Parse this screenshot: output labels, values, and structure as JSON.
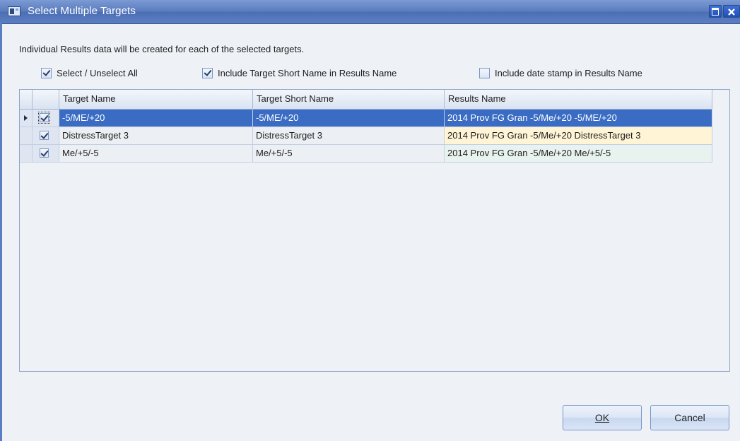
{
  "window": {
    "title": "Select Multiple Targets"
  },
  "description": "Individual Results data will be created for each of the selected targets.",
  "options": [
    {
      "label": "Select / Unselect All",
      "checked": true
    },
    {
      "label": "Include Target Short Name in Results Name",
      "checked": true
    },
    {
      "label": "Include date stamp in Results Name",
      "checked": false
    }
  ],
  "grid": {
    "columns": [
      "Target Name",
      "Target Short Name",
      "Results Name"
    ],
    "rows": [
      {
        "checked": true,
        "target_name": "-5/ME/+20",
        "short_name": "-5/ME/+20",
        "results_name": "2014 Prov FG Gran -5/Me/+20 -5/ME/+20",
        "selected": true
      },
      {
        "checked": true,
        "target_name": "DistressTarget 3",
        "short_name": "DistressTarget 3",
        "results_name": "2014 Prov FG Gran -5/Me/+20 DistressTarget 3",
        "selected": false
      },
      {
        "checked": true,
        "target_name": "Me/+5/-5",
        "short_name": "Me/+5/-5",
        "results_name": "2014 Prov FG Gran -5/Me/+20 Me/+5/-5",
        "selected": false
      }
    ]
  },
  "buttons": {
    "ok": "OK",
    "cancel": "Cancel"
  },
  "colors": {
    "titlebar": "#5a7cbf",
    "selected_row": "#3a6cc3",
    "highlight_row": "#fff4d6"
  }
}
